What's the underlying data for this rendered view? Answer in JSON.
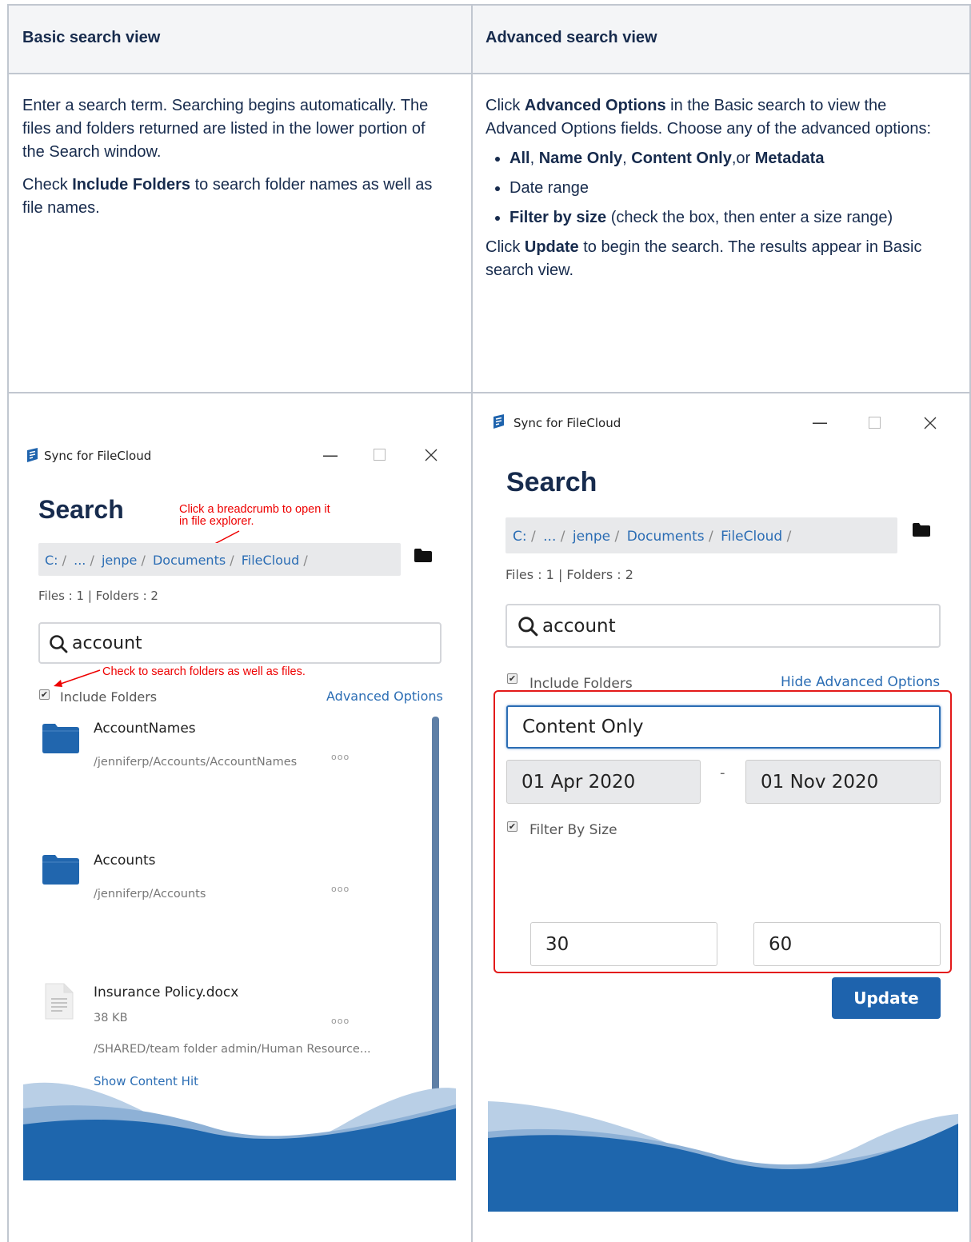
{
  "table": {
    "headers": [
      "Basic search view",
      "Advanced search view"
    ],
    "basic": {
      "para1": "Enter a search term. Searching begins automatically. The files and folders returned are listed in the lower portion of the Search window.",
      "para2_pre": "Check ",
      "para2_bold": "Include Folders",
      "para2_post": " to search folder names as well as file names."
    },
    "advanced": {
      "p1_pre": "Click ",
      "p1_bold": "Advanced Options",
      "p1_post": " in the Basic search to view the Advanced Options fields. Choose any of the advanced options:",
      "li1_b1": "All",
      "li1_sep1": ", ",
      "li1_b2": "Name Only",
      "li1_sep2": ", ",
      "li1_b3": "Content Only",
      "li1_sep3": ",or ",
      "li1_b4": "Metadata",
      "li2": "Date range",
      "li3_bold": "Filter by size",
      "li3_post": " (check the box, then enter a size range)",
      "p2_pre": "Click ",
      "p2_bold": "Update",
      "p2_post": " to begin the search. The results appear in Basic search view."
    }
  },
  "app": {
    "title": "Sync for FileCloud",
    "heading": "Search",
    "breadcrumbs": [
      "C:",
      "...",
      "jenpe",
      "Documents",
      "FileCloud"
    ],
    "counts": "Files : 1 | Folders : 2",
    "search_value": "account",
    "include_folders_label": "Include Folders",
    "advanced_options_link": "Advanced Options",
    "hide_advanced_link": "Hide Advanced Options",
    "accent_color": "#1e63ad"
  },
  "annotations": {
    "breadcrumb_line1": "Click a breadcrumb to open it",
    "breadcrumb_line2": "in file explorer.",
    "check_hint": "Check to search folders as well as files."
  },
  "results": [
    {
      "name": "AccountNames",
      "path": "/jenniferp/Accounts/AccountNames",
      "type": "folder",
      "more": "ooo"
    },
    {
      "name": "Accounts",
      "path": "/jenniferp/Accounts",
      "type": "folder",
      "more": "ooo"
    },
    {
      "name": "Insurance Policy.docx",
      "size": "38 KB",
      "path": "/SHARED/team folder admin/Human Resource...",
      "type": "file",
      "more": "ooo",
      "extra_link": "Show Content Hit"
    }
  ],
  "advanced_form": {
    "search_in": "Content Only",
    "date_from": "01 Apr 2020",
    "date_sep": "-",
    "date_to": "01 Nov 2020",
    "filter_by_size_label": "Filter By Size",
    "size_min": "30",
    "size_max": "60",
    "update_label": "Update"
  }
}
